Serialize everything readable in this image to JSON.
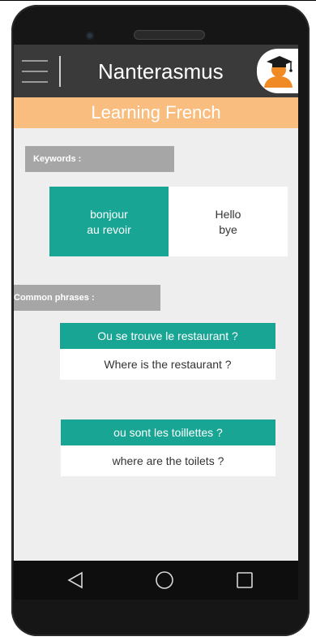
{
  "app": {
    "title": "Nanterasmus",
    "subtitle": "Learning French"
  },
  "icons": {
    "menu": "hamburger-menu-icon",
    "avatar": "graduate-avatar-icon",
    "back": "back-triangle-icon",
    "home": "home-circle-icon",
    "recents": "recents-square-icon"
  },
  "colors": {
    "appbar": "#3a3a3a",
    "banner": "#f9bd7f",
    "accent": "#18a594",
    "section_label": "#a6a6a6",
    "avatar_orange": "#f08a24"
  },
  "keywords": {
    "label": "Keywords :",
    "french": [
      "bonjour",
      "au revoir"
    ],
    "english": [
      "Hello",
      "bye"
    ]
  },
  "phrases": {
    "label": "Common phrases :",
    "items": [
      {
        "french": "Ou se trouve le restaurant ?",
        "english": "Where is the restaurant ?"
      },
      {
        "french": "ou sont les toillettes ?",
        "english": "where are the toilets ?"
      }
    ]
  }
}
